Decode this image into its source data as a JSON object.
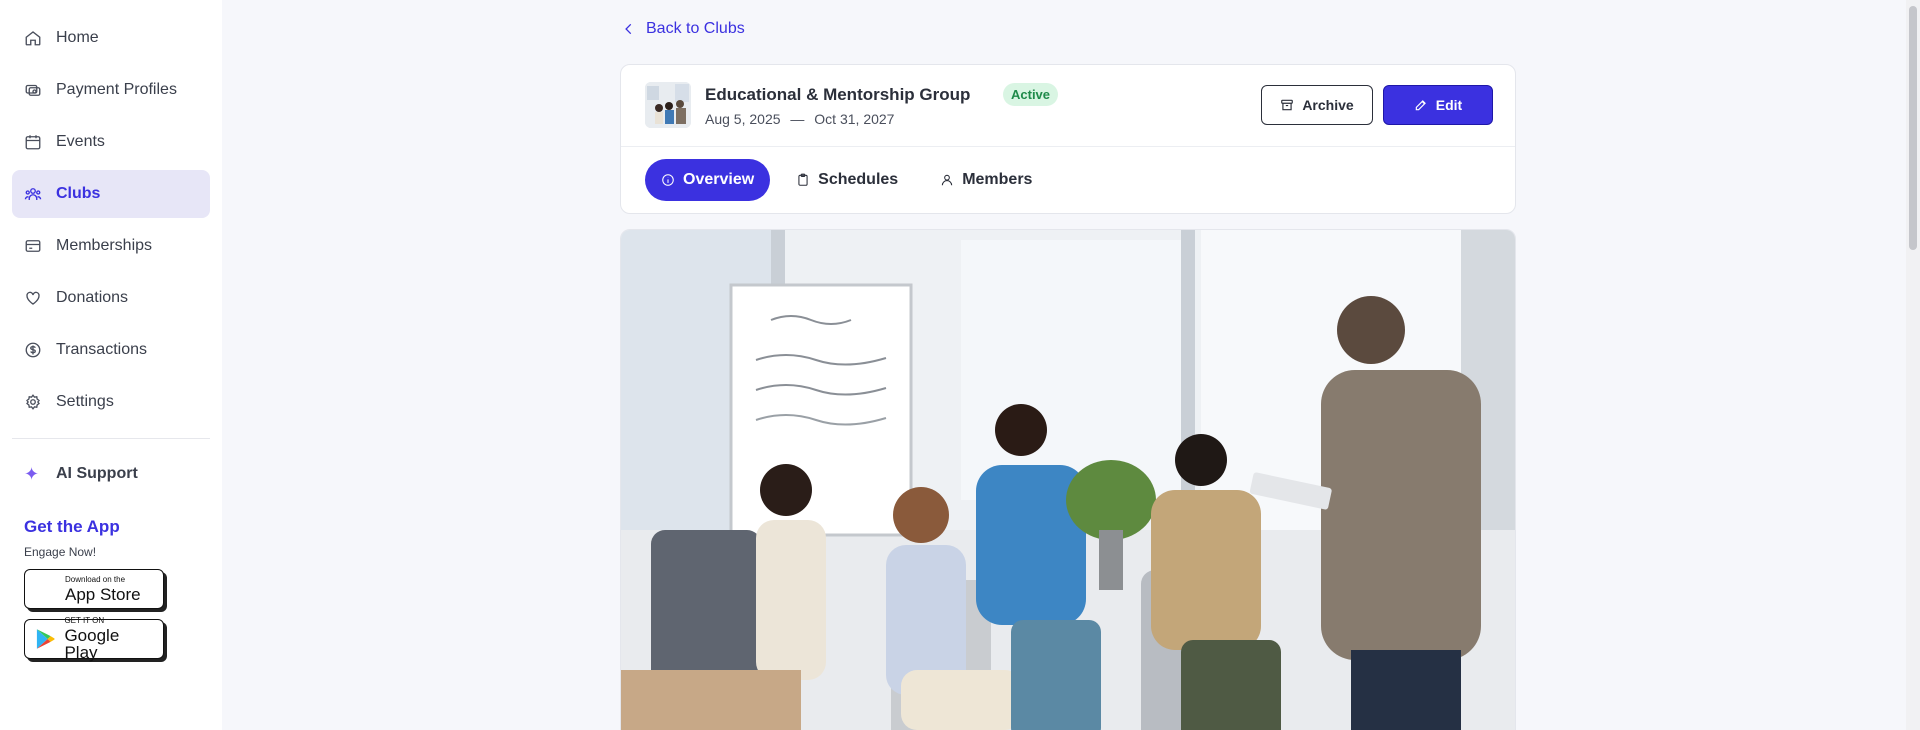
{
  "sidebar": {
    "items": [
      {
        "label": "Home",
        "icon": "home-icon"
      },
      {
        "label": "Payment Profiles",
        "icon": "payment-icon"
      },
      {
        "label": "Events",
        "icon": "calendar-icon"
      },
      {
        "label": "Clubs",
        "icon": "users-icon",
        "active": true
      },
      {
        "label": "Memberships",
        "icon": "card-icon"
      },
      {
        "label": "Donations",
        "icon": "heart-icon"
      },
      {
        "label": "Transactions",
        "icon": "dollar-icon"
      },
      {
        "label": "Settings",
        "icon": "gear-icon"
      }
    ],
    "ai_support": "AI Support",
    "get_app": {
      "title": "Get the App",
      "subtitle": "Engage Now!",
      "app_store_small": "Download on the",
      "app_store_big": "App Store",
      "google_play_small": "GET IT ON",
      "google_play_big": "Google Play"
    }
  },
  "main": {
    "back_link": "Back to Clubs",
    "club": {
      "name": "Educational & Mentorship Group",
      "status": "Active",
      "start_date": "Aug 5, 2025",
      "date_separator": "—",
      "end_date": "Oct 31, 2027"
    },
    "actions": {
      "archive": "Archive",
      "edit": "Edit"
    },
    "tabs": [
      {
        "label": "Overview",
        "icon": "info-icon",
        "active": true
      },
      {
        "label": "Schedules",
        "icon": "clipboard-icon"
      },
      {
        "label": "Members",
        "icon": "user-icon"
      }
    ]
  },
  "colors": {
    "accent": "#3b31e0",
    "active_bg": "#e7e6f7",
    "status_green": "#1f8a4a"
  }
}
